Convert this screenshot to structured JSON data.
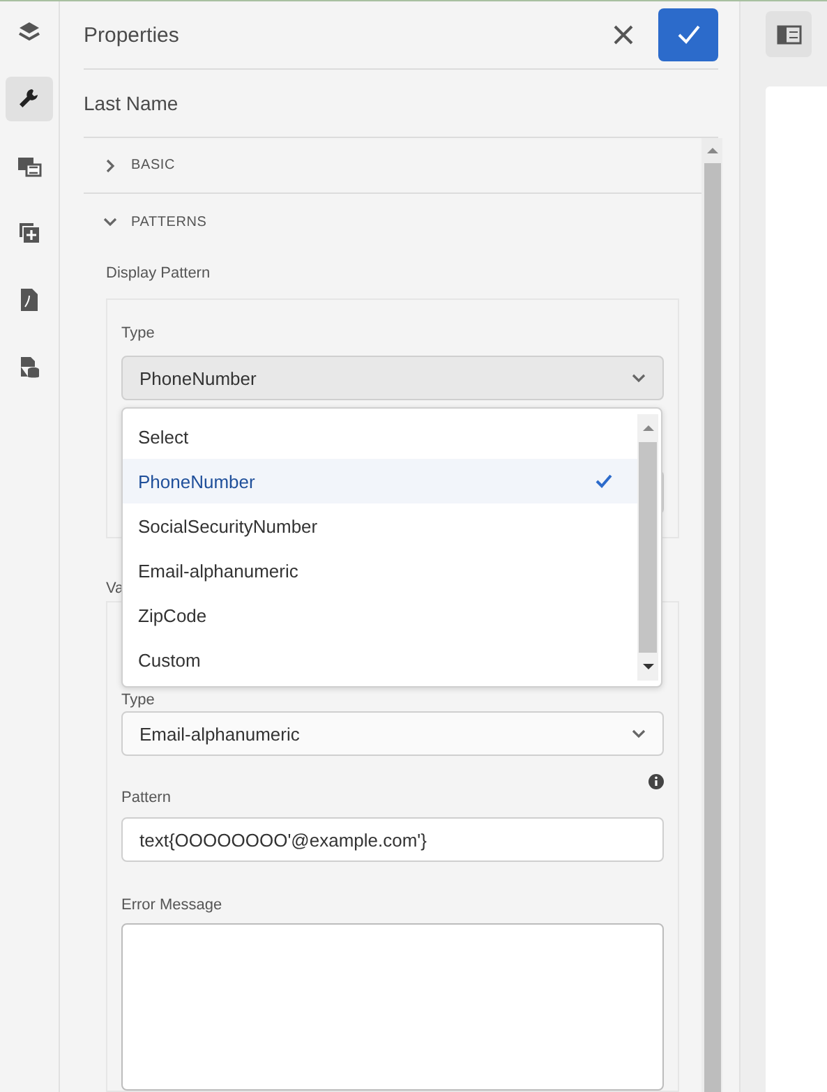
{
  "rail": [
    {
      "kind": "layers",
      "selected": false
    },
    {
      "kind": "wrench",
      "selected": true
    },
    {
      "kind": "media",
      "selected": false
    },
    {
      "kind": "add",
      "selected": false
    },
    {
      "kind": "pdf",
      "selected": false
    },
    {
      "kind": "data",
      "selected": false
    }
  ],
  "panel": {
    "title": "Properties",
    "component": "Last Name"
  },
  "sections": [
    {
      "label": "BASIC",
      "expanded": false
    },
    {
      "label": "PATTERNS",
      "expanded": true
    }
  ],
  "display_pattern": {
    "label": "Display Pattern",
    "type_label": "Type",
    "type_value": "PhoneNumber"
  },
  "dropdown": [
    {
      "label": "Select",
      "selected": false
    },
    {
      "label": "PhoneNumber",
      "selected": true
    },
    {
      "label": "SocialSecurityNumber",
      "selected": false
    },
    {
      "label": "Email-alphanumeric",
      "selected": false
    },
    {
      "label": "ZipCode",
      "selected": false
    },
    {
      "label": "Custom",
      "selected": false
    }
  ],
  "validation_pattern": {
    "label": "Va",
    "type_label": "Type",
    "type_value": "Email-alphanumeric",
    "pattern_label": "Pattern",
    "pattern_value": "text{OOOOOOOO'@example.com'}",
    "error_label": "Error Message"
  }
}
